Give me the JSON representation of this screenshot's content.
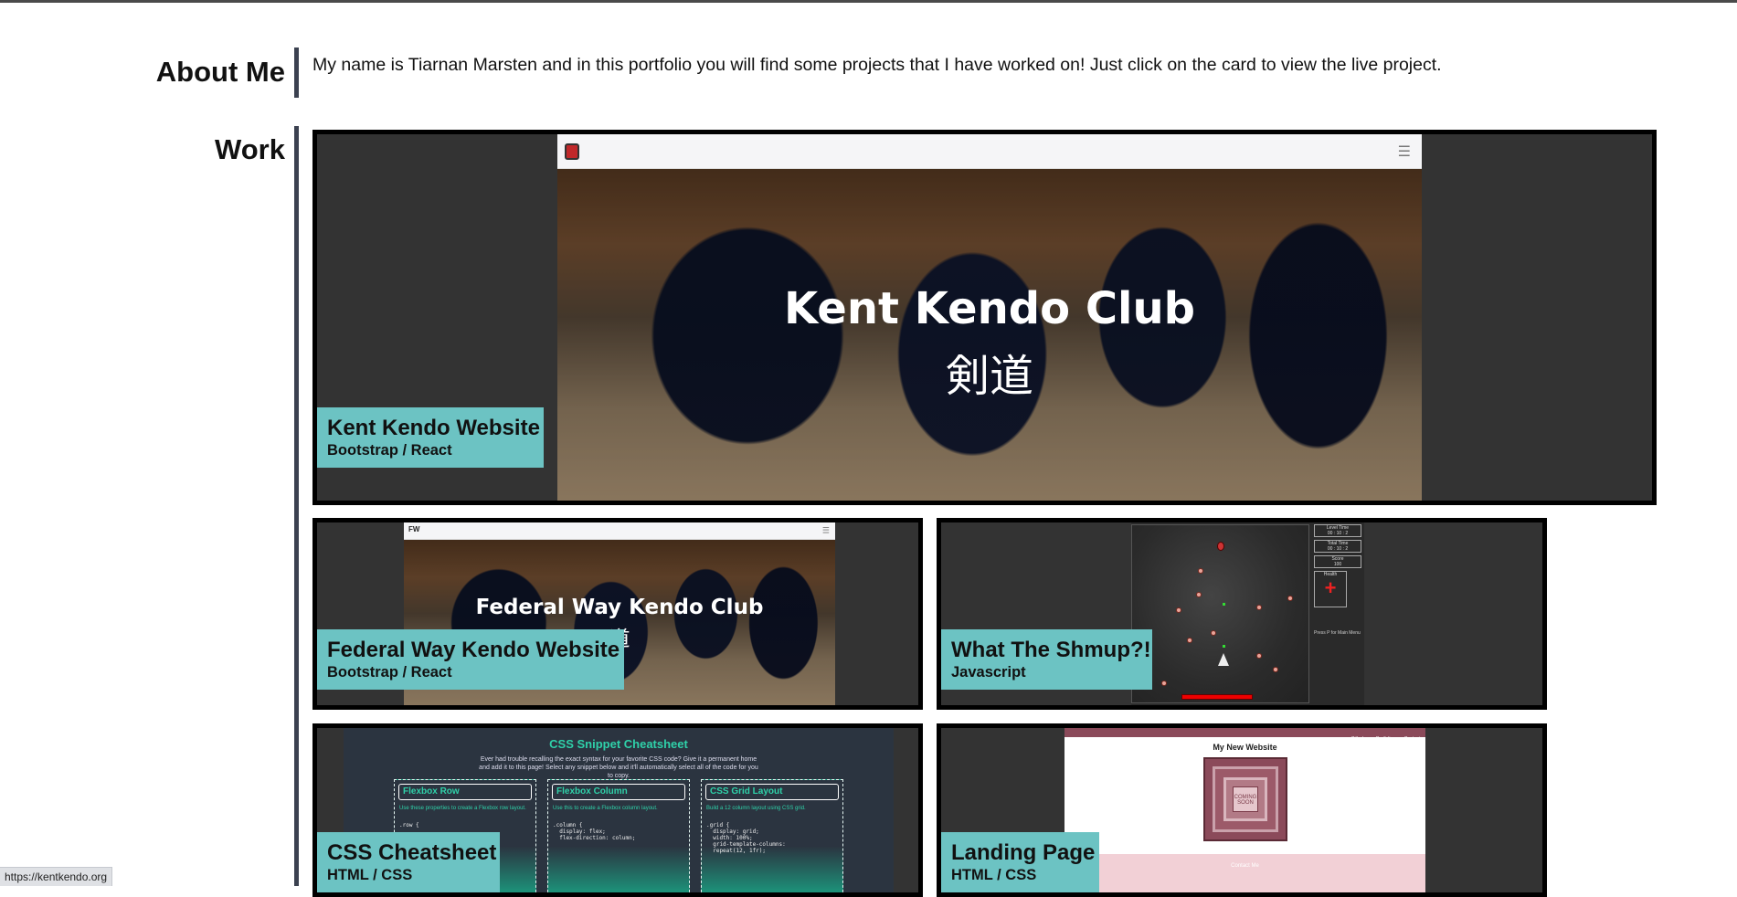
{
  "about": {
    "heading": "About Me",
    "text": "My name is Tiarnan Marsten and in this portfolio you will find some projects that I have worked on! Just click on the card to view the live project."
  },
  "work": {
    "heading": "Work",
    "cards": [
      {
        "title": "Kent Kendo Website",
        "subtitle": "Bootstrap / React",
        "hero_line1": "Kent Kendo Club",
        "hero_line2": "剣道"
      },
      {
        "title": "Federal Way Kendo Website",
        "subtitle": "Bootstrap / React",
        "hero_line1": "Federal Way Kendo Club",
        "hero_line2": "道",
        "nav_logo": "FW"
      },
      {
        "title": "What The Shmup?!",
        "subtitle": "Javascript",
        "hud": {
          "level_time_label": "Level Time",
          "level_time": "00 : 10 : 2",
          "total_time_label": "Total Time",
          "total_time": "00 : 10 : 2",
          "score_label": "Score",
          "score": "100",
          "health_label": "Health",
          "pause_hint": "Press P for Main Menu"
        }
      },
      {
        "title": "CSS Cheatsheet",
        "subtitle": "HTML / CSS",
        "sheet": {
          "title": "CSS Snippet Cheatsheet",
          "intro": "Ever had trouble recalling the exact syntax for your favorite CSS code? Give it a permanent home and add it to this page! Select any snippet below and it'll automatically select all of the code for you to copy.",
          "columns": [
            {
              "name": "Flexbox Row",
              "desc": "Use these properties to create a Flexbox row layout.",
              "code": ".row {"
            },
            {
              "name": "Flexbox Column",
              "desc": "Use this to create a Flexbox column layout.",
              "code": ".column {\n  display: flex;\n  flex-direction: column;"
            },
            {
              "name": "CSS Grid Layout",
              "desc": "Build a 12 column layout using CSS grid.",
              "code": ".grid {\n  display: grid;\n  width: 100%;\n  grid-template-columns:\n  repeat(12, 1fr);"
            }
          ]
        }
      },
      {
        "title": "Landing Page",
        "subtitle": "HTML / CSS",
        "landing": {
          "nav": [
            "Github",
            "Portfolio",
            "Contact"
          ],
          "site_title": "My New Website",
          "badge": "COMING SOON",
          "section": "Contact Me"
        }
      }
    ]
  },
  "status_url": "https://kentkendo.org"
}
